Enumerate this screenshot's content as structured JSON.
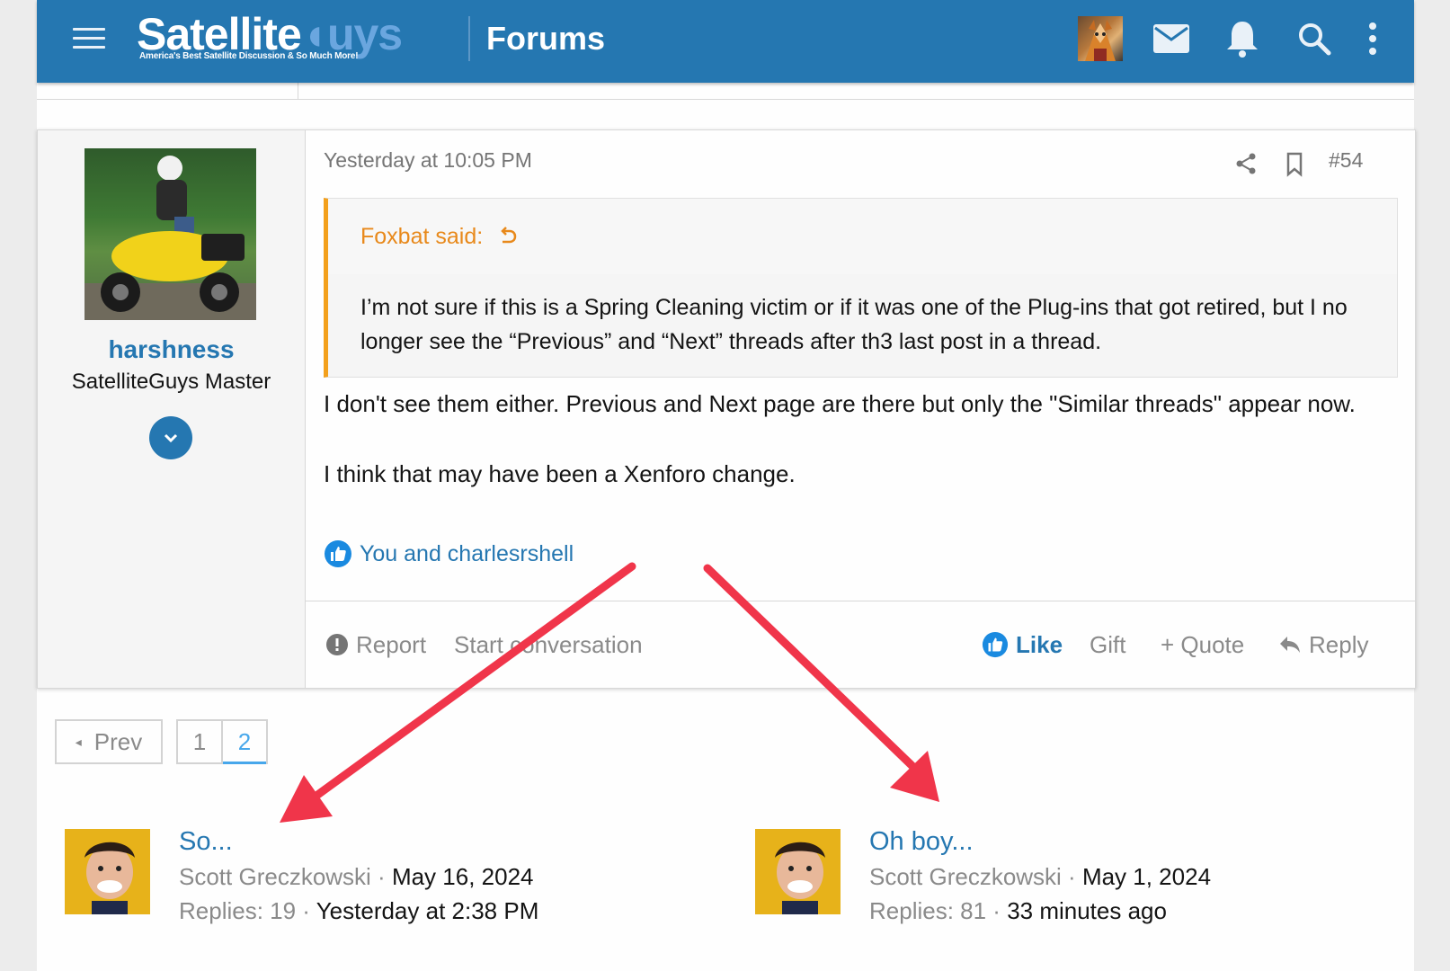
{
  "header": {
    "logo_main": "Satellite",
    "logo_accent": "uys",
    "logo_tagline": "America's Best Satellite Discussion & So Much More!",
    "section_title": "Forums",
    "brand_color": "#2577b1"
  },
  "post": {
    "date": "Yesterday at 10:05 PM",
    "number": "#54",
    "user": {
      "name": "harshness",
      "title": "SatelliteGuys Master"
    },
    "quote": {
      "author": "Foxbat said:",
      "text": "I’m not sure if this is a Spring Cleaning victim or if it was one of the Plug-ins that got retired, but I no longer see the “Previous” and “Next” threads after th3 last post in a thread."
    },
    "body_p1": "I don't see them either. Previous and Next page are there but only the \"Similar threads\" appear now.",
    "body_p2": "I think that may have been a Xenforo change.",
    "reactions": "You and charlesrshell",
    "actions": {
      "report": "Report",
      "start_conversation": "Start conversation",
      "like": "Like",
      "gift": "Gift",
      "quote": "+ Quote",
      "reply": "Reply"
    }
  },
  "pagination": {
    "prev": "Prev",
    "pages": [
      "1",
      "2"
    ],
    "current": "2"
  },
  "similar_threads": [
    {
      "title": "So...",
      "author": "Scott Greczkowski",
      "date": "May 16, 2024",
      "replies_label": "Replies: 19",
      "last": "Yesterday at 2:38 PM"
    },
    {
      "title": "Oh boy...",
      "author": "Scott Greczkowski",
      "date": "May 1, 2024",
      "replies_label": "Replies: 81",
      "last": "33 minutes ago"
    }
  ],
  "annotation_color": "#f0354a"
}
